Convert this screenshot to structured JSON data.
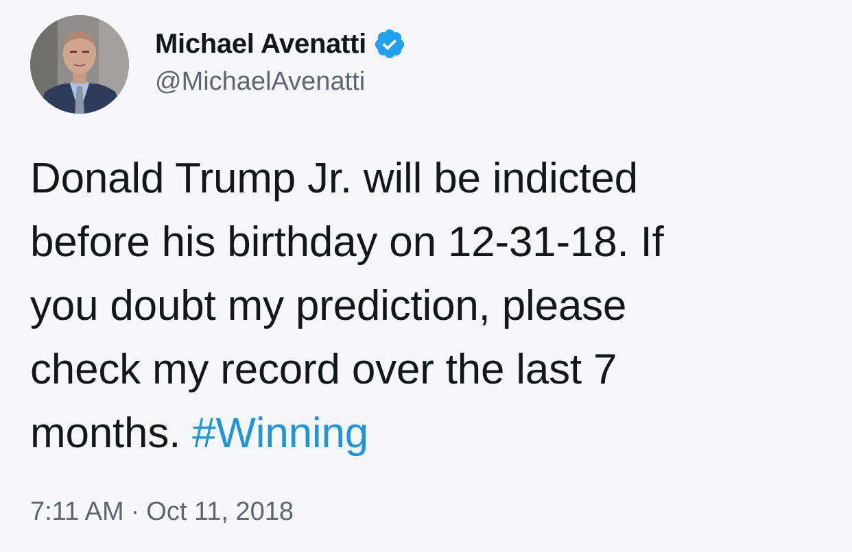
{
  "tweet": {
    "author": {
      "display_name": "Michael Avenatti",
      "handle": "@MichaelAvenatti",
      "verified": true
    },
    "text_lines": [
      "Donald Trump Jr. will be indicted",
      "before his birthday on 12-31-18. If",
      "you doubt my prediction, please",
      "check my record over the last 7",
      "months. "
    ],
    "hashtag": "#Winning",
    "time": "7:11 AM",
    "separator": "·",
    "date": "Oct 11, 2018"
  },
  "colors": {
    "text": "#14171a",
    "secondary_text": "#5b6670",
    "link": "#1b95e0",
    "verified_badge": "#1da1f2",
    "background": "#f7f7fa"
  },
  "icons": {
    "verified": "verified-badge-icon",
    "avatar": "profile-photo"
  }
}
